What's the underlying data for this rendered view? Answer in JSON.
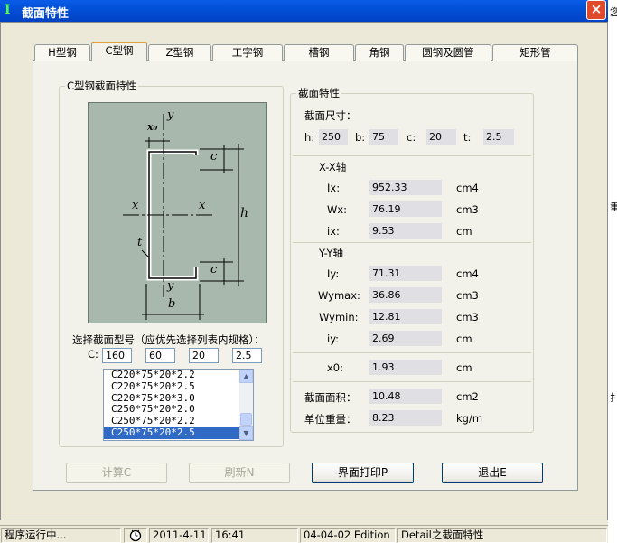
{
  "window": {
    "title": "截面特性",
    "close": "×"
  },
  "tabs": [
    "H型钢",
    "C型钢",
    "Z型钢",
    "工字钢",
    "槽钢",
    "角钢",
    "圆钢及圆管",
    "矩形管"
  ],
  "left_group": {
    "legend": "C型钢截面特性",
    "drawing_labels": {
      "x0": "x₀",
      "y_top": "y",
      "y_bottom": "y",
      "x_left": "x",
      "x_right": "x",
      "c_top": "c",
      "c_bottom": "c",
      "h": "h",
      "t": "t",
      "b": "b"
    },
    "select_label": "选择截面型号（应优先选择列表内规格）：",
    "c_label": "C:",
    "inputs": [
      "160",
      "60",
      "20",
      "2.5"
    ],
    "list_items": [
      "C220*75*20*2.2",
      "C220*75*20*2.5",
      "C220*75*20*3.0",
      "C250*75*20*2.0",
      "C250*75*20*2.2",
      "C250*75*20*2.5"
    ],
    "selected_index": 5
  },
  "props": {
    "legend": "截面特性",
    "dims_title": "截面尺寸：",
    "dims": [
      {
        "label": "h:",
        "value": "250"
      },
      {
        "label": "b:",
        "value": "75"
      },
      {
        "label": "c:",
        "value": "20"
      },
      {
        "label": "t:",
        "value": "2.5"
      }
    ],
    "xx_title": "X-X轴",
    "xx_rows": [
      {
        "label": "Ix:",
        "value": "952.33",
        "unit": "cm4"
      },
      {
        "label": "Wx:",
        "value": "76.19",
        "unit": "cm3"
      },
      {
        "label": "ix:",
        "value": "9.53",
        "unit": "cm"
      }
    ],
    "yy_title": "Y-Y轴",
    "yy_rows": [
      {
        "label": "Iy:",
        "value": "71.31",
        "unit": "cm4"
      },
      {
        "label": "Wymax:",
        "value": "36.86",
        "unit": "cm3"
      },
      {
        "label": "Wymin:",
        "value": "12.81",
        "unit": "cm3"
      },
      {
        "label": "iy:",
        "value": "2.69",
        "unit": "cm"
      }
    ],
    "x0_row": {
      "label": "x0:",
      "value": "1.93",
      "unit": "cm"
    },
    "area_row": {
      "label": "截面面积：",
      "value": "10.48",
      "unit": "cm2"
    },
    "weight_row": {
      "label": "单位重量：",
      "value": "8.23",
      "unit": "kg/m"
    }
  },
  "buttons": {
    "calc": "计算C",
    "refresh": "刷新N",
    "print": "界面打印P",
    "exit": "退出E"
  },
  "status": {
    "running": "程序运行中...",
    "date": "2011-4-11",
    "time": "16:41",
    "edition": "04-04-02 Edition",
    "module": "Detail之截面特性"
  },
  "side_glyphs": [
    "您",
    "重",
    "扌"
  ],
  "colors": {
    "titlebar": "#0250D8",
    "selection": "#316AC5",
    "drawing_bg": "#A9B8AD"
  }
}
